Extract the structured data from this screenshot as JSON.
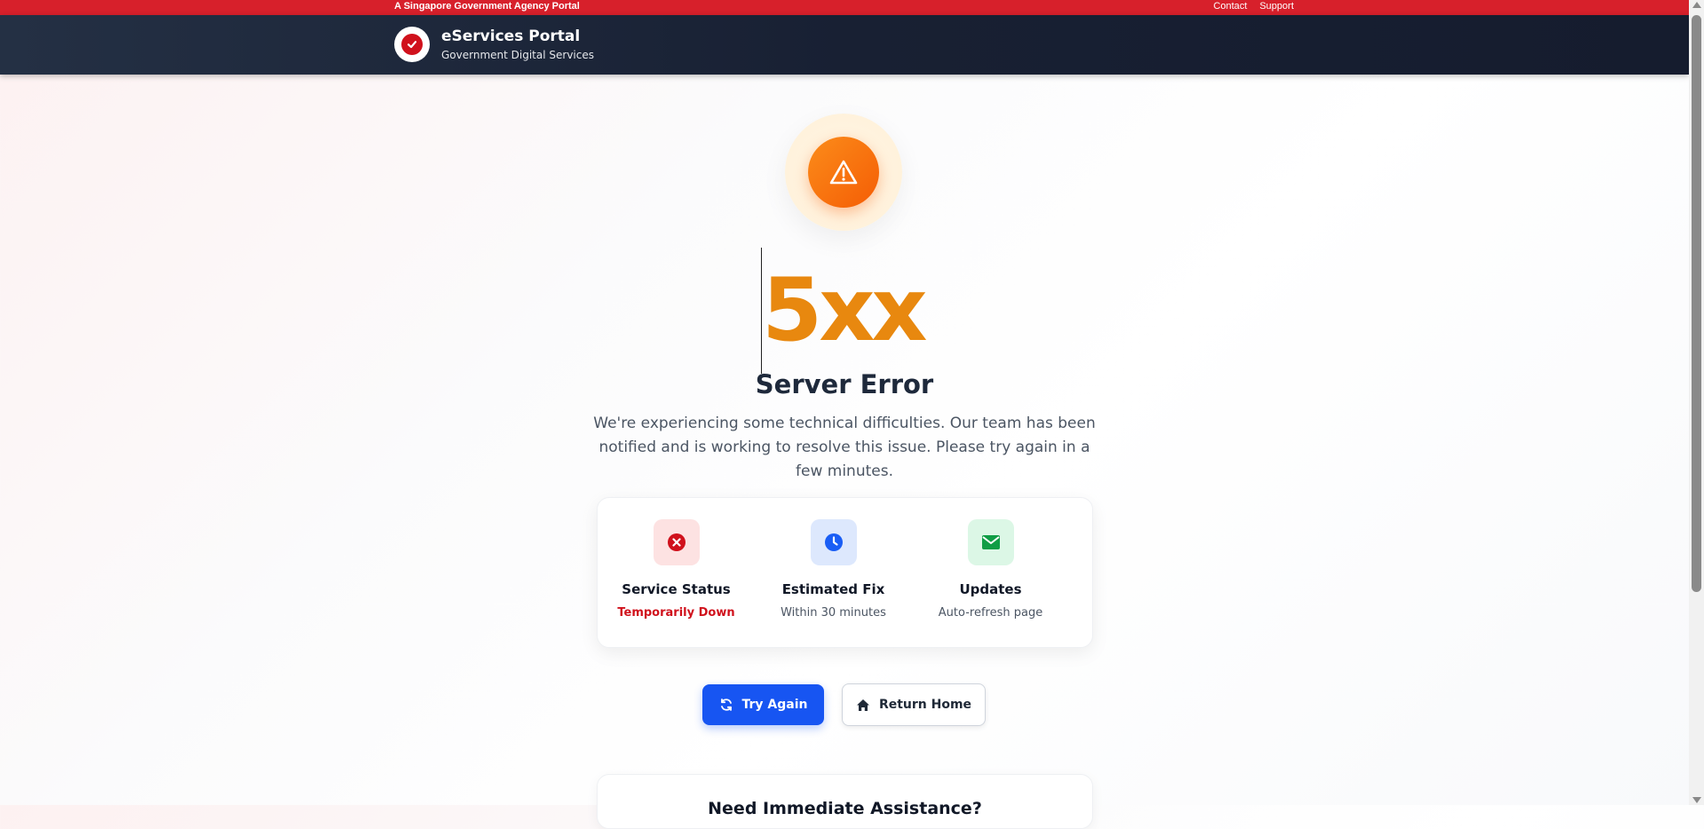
{
  "topbar": {
    "agency_text": "A Singapore Government Agency Portal",
    "links": [
      "Contact",
      "Support"
    ]
  },
  "header": {
    "title": "eServices Portal",
    "subtitle": "Government Digital Services"
  },
  "error": {
    "code": "5xx",
    "title": "Server Error",
    "description": "We're experiencing some technical difficulties. Our team has been notified and is working to resolve this issue. Please try again in a few minutes."
  },
  "status": [
    {
      "label": "Service Status",
      "value": "Temporarily Down",
      "icon": "x-circle-icon",
      "color": "#d0111c",
      "bg": "#fde2e2"
    },
    {
      "label": "Estimated Fix",
      "value": "Within 30 minutes",
      "icon": "clock-icon",
      "color": "#1a5ef5",
      "bg": "#dde8fd"
    },
    {
      "label": "Updates",
      "value": "Auto-refresh page",
      "icon": "envelope-icon",
      "color": "#0f9d45",
      "bg": "#dcf7e6"
    }
  ],
  "actions": {
    "try_again": "Try Again",
    "return_home": "Return Home"
  },
  "help": {
    "heading": "Need Immediate Assistance?"
  },
  "colors": {
    "topbar": "#d7202b",
    "header": "#182033",
    "accent_orange": "#f55d05",
    "code_color": "#e8880f",
    "primary": "#1755f2"
  }
}
